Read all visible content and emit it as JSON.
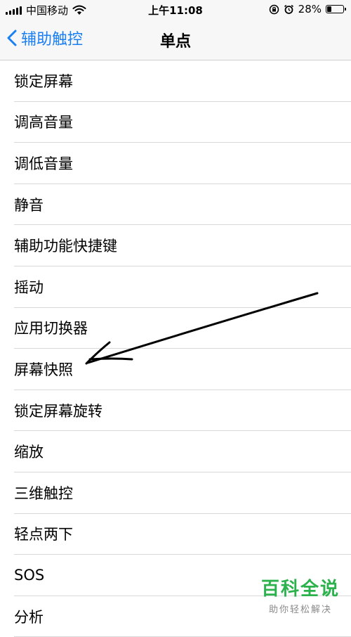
{
  "status_bar": {
    "carrier": "中国移动",
    "time": "上午11:08",
    "battery": "28%",
    "battery_level": 0.28,
    "icons": [
      "signal-icon",
      "wifi-icon",
      "rotation-lock-icon",
      "alarm-icon",
      "battery-icon"
    ]
  },
  "nav": {
    "back_label": "辅助触控",
    "title": "单点"
  },
  "items": [
    {
      "label": "锁定屏幕"
    },
    {
      "label": "调高音量"
    },
    {
      "label": "调低音量"
    },
    {
      "label": "静音"
    },
    {
      "label": "辅助功能快捷键"
    },
    {
      "label": "摇动"
    },
    {
      "label": "应用切换器"
    },
    {
      "label": "屏幕快照"
    },
    {
      "label": "锁定屏幕旋转"
    },
    {
      "label": "缩放"
    },
    {
      "label": "三维触控"
    },
    {
      "label": "轻点两下"
    },
    {
      "label": "SOS"
    },
    {
      "label": "分析"
    }
  ],
  "watermark": {
    "title": "百科全说",
    "subtitle": "助你轻松解决"
  },
  "colors": {
    "accent": "#1a7ff2",
    "watermark": "#2bb24c"
  }
}
